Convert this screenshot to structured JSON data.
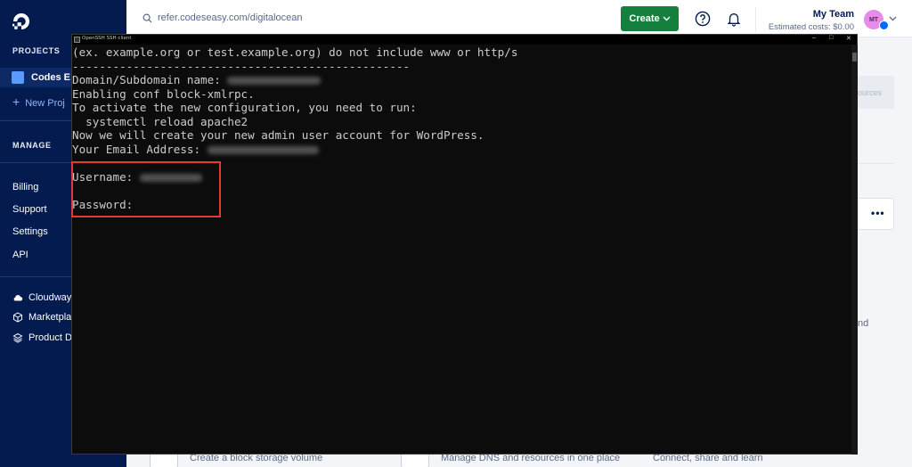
{
  "sidebar": {
    "projects_heading": "PROJECTS",
    "project_name": "Codes E",
    "new_project": "New Proj",
    "manage_heading": "MANAGE",
    "manage_items": [
      "Billing",
      "Support",
      "Settings",
      "API"
    ],
    "extra_items": [
      {
        "label": "Cloudway",
        "icon": "cloud-icon"
      },
      {
        "label": "Marketpla",
        "icon": "cube-icon"
      },
      {
        "label": "Product D",
        "icon": "layers-icon"
      }
    ]
  },
  "header": {
    "search_text": "refer.codeseasy.com/digitalocean",
    "create_label": "Create",
    "team_name": "My Team",
    "estimated_costs": "Estimated costs: $0.00",
    "avatar_initials": "MT"
  },
  "background": {
    "card_fragment": "ources",
    "right_fragment": "nd",
    "bottom_items": [
      "Create a block storage volume",
      "Manage DNS and resources in one place",
      "Connect, share and learn"
    ]
  },
  "terminal": {
    "window_title": "OpenSSH SSH client",
    "lines": [
      {
        "text": "(ex. example.org or test.example.org) do not include www or http/s",
        "redacted_width": 0
      },
      {
        "text": "--------------------------------------------------",
        "redacted_width": 0
      },
      {
        "text": "Domain/Subdomain name: ",
        "redacted_width": 105
      },
      {
        "text": "Enabling conf block-xmlrpc.",
        "redacted_width": 0
      },
      {
        "text": "To activate the new configuration, you need to run:",
        "redacted_width": 0
      },
      {
        "text": "  systemctl reload apache2",
        "redacted_width": 0
      },
      {
        "text": "Now we will create your new admin user account for WordPress.",
        "redacted_width": 0
      },
      {
        "text": "Your Email Address: ",
        "redacted_width": 125
      },
      {
        "text": "",
        "redacted_width": 0
      },
      {
        "text": "Username: ",
        "redacted_width": 70
      },
      {
        "text": "",
        "redacted_width": 0
      },
      {
        "text": "Password:",
        "redacted_width": 0
      }
    ]
  },
  "colors": {
    "sidebar_bg": "#031b4e",
    "create_button": "#15803d",
    "terminal_bg": "#0c0c0c",
    "terminal_text": "#cccccc",
    "highlight_box": "#e53935"
  }
}
